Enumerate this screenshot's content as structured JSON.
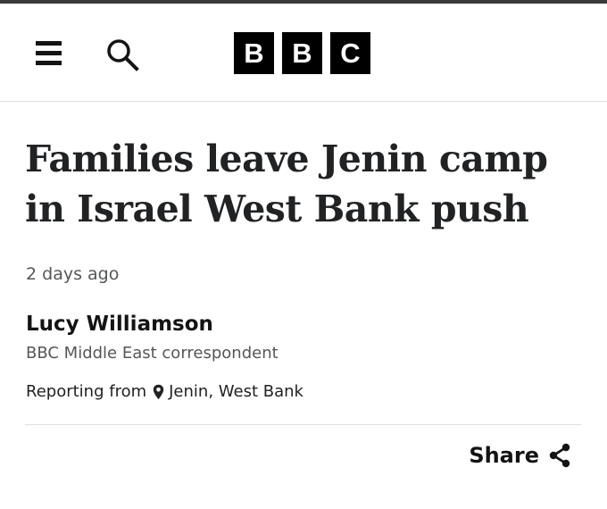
{
  "header": {
    "logo_letters": [
      "B",
      "B",
      "C"
    ],
    "menu_icon": "menu-icon",
    "search_icon": "search-icon"
  },
  "article": {
    "headline": "Families leave Jenin camp in Israel West Bank push",
    "timestamp": "2 days ago",
    "author": {
      "name": "Lucy Williamson",
      "role": "BBC Middle East correspondent"
    },
    "reporting": {
      "prefix": "Reporting from",
      "location": "Jenin, West Bank",
      "icon": "location-pin-icon"
    }
  },
  "share": {
    "label": "Share",
    "icon": "share-icon"
  }
}
